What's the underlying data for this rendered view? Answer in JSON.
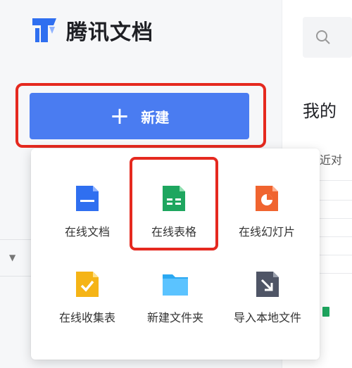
{
  "brand": {
    "name": "腾讯文档"
  },
  "new_button": {
    "label": "新建",
    "icon": "plus-icon"
  },
  "main": {
    "search_icon": "search-icon",
    "section_title": "我的",
    "tab_label": "近对"
  },
  "menu": {
    "items": [
      {
        "label": "在线文档",
        "icon": "doc-icon",
        "color": "#2f6ff0"
      },
      {
        "label": "在线表格",
        "icon": "sheet-icon",
        "color": "#1ea65f"
      },
      {
        "label": "在线幻灯片",
        "icon": "slides-icon",
        "color": "#f0642f"
      },
      {
        "label": "在线收集表",
        "icon": "form-icon",
        "color": "#f5b416"
      },
      {
        "label": "新建文件夹",
        "icon": "folder-icon",
        "color": "#2aa8f2"
      },
      {
        "label": "导入本地文件",
        "icon": "import-icon",
        "color": "#4f5566"
      }
    ]
  },
  "colors": {
    "accent": "#4a7cf1",
    "highlight": "#e5291f"
  }
}
